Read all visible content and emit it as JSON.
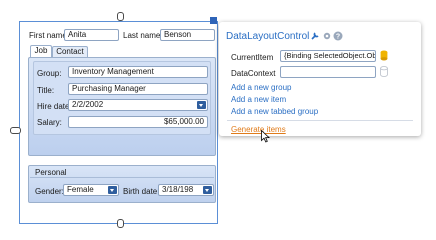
{
  "form": {
    "first_name_label": "First name:",
    "first_name_value": "Anita",
    "last_name_label": "Last name:",
    "last_name_value": "Benson",
    "tabs": [
      {
        "label": "Job"
      },
      {
        "label": "Contact"
      }
    ],
    "group_label": "Group:",
    "group_value": "Inventory Management",
    "title_label": "Title:",
    "title_value": "Purchasing Manager",
    "hire_date_label": "Hire date:",
    "hire_date_value": "2/2/2002",
    "salary_label": "Salary:",
    "salary_value": "$65,000.00",
    "personal_header": "Personal",
    "gender_label": "Gender:",
    "gender_value": "Female",
    "birth_date_label": "Birth date:",
    "birth_date_value": "3/18/198"
  },
  "smart_tag": {
    "title": "DataLayoutControl",
    "current_item_label": "CurrentItem",
    "current_item_value": "{Binding SelectedObject.Obj}",
    "data_context_label": "DataContext",
    "data_context_value": "",
    "links": [
      "Add a new group",
      "Add a new item",
      "Add a new tabbed group"
    ],
    "generate_items": "Generate items"
  },
  "colors": {
    "accent_blue": "#2b6fc4",
    "group_bg": "#cfddf3",
    "generate_link": "#e07b1a",
    "icon_yellow": "#f0b400"
  }
}
